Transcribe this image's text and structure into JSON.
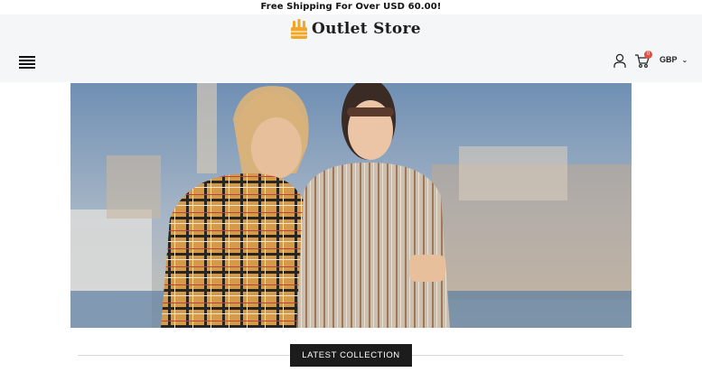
{
  "announcement": {
    "text": "Free Shipping For Over USD 60.00!"
  },
  "header": {
    "logo_text": "Outlet Store",
    "cart_count": "0",
    "currency": "GBP",
    "icons": {
      "menu": "hamburger-menu-icon",
      "account": "user-icon",
      "cart": "cart-icon",
      "currency_toggle": "chevron-down-icon"
    }
  },
  "hero": {
    "image_name": "hero-banner-two-women"
  },
  "section": {
    "button_label": "LATEST COLLECTION"
  },
  "colors": {
    "header_bg": "#f5f6f8",
    "badge": "#e84d3d",
    "button_bg": "#1c1c1c",
    "logo_accent": "#f1a629"
  }
}
